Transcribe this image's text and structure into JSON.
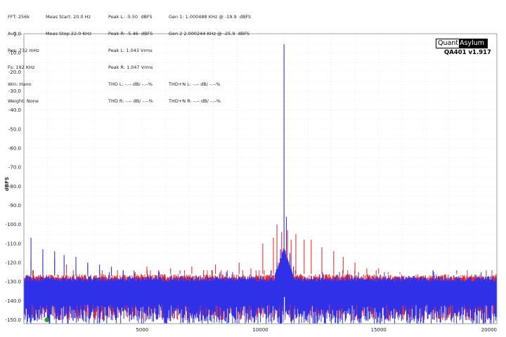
{
  "header": {
    "col1": [
      "FFT: 256k",
      "Avg: --",
      "Res: 732 mHz",
      "Fs: 192 KHz",
      "Win: Hann",
      "Weight: None"
    ],
    "col2": [
      "Meas Start: 20.0 Hz",
      "Meas Stop 22.0 KHz"
    ],
    "col3": [
      "Peak L: -5.50  dBFS",
      "Peak R: -5.46  dBFS",
      "Peak L: 1.043 Vrms",
      "Peak R: 1.047 Vrms",
      "THD L: -.-- dB/ -.--%",
      "THD R: -.-- dB/ -.--%"
    ],
    "col4": [
      "Gen 1: 1.000488 KHz @ -19.9  dBFS",
      "Gen 2 2.000244 KHz @ -25.9  dBFS",
      "",
      "",
      "THD+N L: -.-- dB/ -.--%",
      "THD+N R: -.-- dB/ -.--%"
    ]
  },
  "logo": {
    "part1": "Quant",
    "part2": "Asylum",
    "version": "QA401 v1.917"
  },
  "marker": {
    "color": "#22aa22"
  },
  "chart_data": {
    "type": "line",
    "xlabel": "",
    "ylabel": "dBFS",
    "xlim": [
      0,
      20000
    ],
    "ylim": [
      -152,
      0
    ],
    "xticks": [
      5000,
      10000,
      15000,
      20000
    ],
    "yticks": [
      0,
      -10,
      -20,
      -30,
      -40,
      -50,
      -60,
      -70,
      -80,
      -90,
      -100,
      -110,
      -120,
      -130,
      -140,
      -150
    ],
    "grid": true,
    "colors": {
      "left": "#3030e8",
      "right": "#e83030"
    },
    "fundamental": {
      "x": 11000,
      "y": -5.5
    },
    "series": [
      {
        "color": "#e83030",
        "noise_floor": [
          -150,
          -126
        ],
        "spikes": [
          [
            300,
            -118
          ],
          [
            800,
            -116
          ],
          [
            1300,
            -118
          ],
          [
            1800,
            -121
          ],
          [
            2200,
            -124
          ],
          [
            2700,
            -121
          ],
          [
            3200,
            -124
          ],
          [
            3700,
            -122
          ],
          [
            4200,
            -124
          ],
          [
            4700,
            -125
          ],
          [
            5200,
            -122
          ],
          [
            5700,
            -124
          ],
          [
            6200,
            -123
          ],
          [
            6600,
            -124
          ],
          [
            7100,
            -122
          ],
          [
            7600,
            -124
          ],
          [
            8100,
            -121
          ],
          [
            8600,
            -124
          ],
          [
            9100,
            -120
          ],
          [
            9600,
            -123
          ],
          [
            10100,
            -110
          ],
          [
            10550,
            -107
          ],
          [
            10700,
            -100
          ],
          [
            10900,
            -104
          ],
          [
            11150,
            -103
          ],
          [
            11300,
            -108
          ],
          [
            11500,
            -105
          ],
          [
            11850,
            -108
          ],
          [
            12150,
            -108
          ],
          [
            12600,
            -112
          ],
          [
            13100,
            -114
          ],
          [
            13500,
            -117
          ],
          [
            14000,
            -120
          ],
          [
            14500,
            -123
          ],
          [
            15000,
            -123
          ],
          [
            15400,
            -125
          ],
          [
            15900,
            -125
          ],
          [
            16400,
            -126
          ],
          [
            17300,
            -124
          ],
          [
            18300,
            -124
          ],
          [
            19300,
            -126
          ]
        ]
      },
      {
        "color": "#3030e8",
        "noise_floor": [
          -152,
          -127
        ],
        "spikes": [
          [
            300,
            -107
          ],
          [
            800,
            -113
          ],
          [
            1300,
            -114
          ],
          [
            1700,
            -116
          ],
          [
            2200,
            -117
          ],
          [
            2700,
            -120
          ],
          [
            3200,
            -121
          ],
          [
            3700,
            -123
          ],
          [
            4200,
            -124
          ],
          [
            4700,
            -125
          ],
          [
            5700,
            -126
          ],
          [
            6600,
            -127
          ],
          [
            7600,
            -126
          ],
          [
            8600,
            -126
          ],
          [
            9600,
            -126
          ],
          [
            10450,
            -124
          ],
          [
            10700,
            -120
          ],
          [
            10850,
            -113
          ],
          [
            11000,
            -5.5
          ],
          [
            11100,
            -96
          ],
          [
            11250,
            -115
          ],
          [
            11400,
            -122
          ],
          [
            13700,
            -126
          ],
          [
            17300,
            -124
          ]
        ]
      }
    ]
  }
}
